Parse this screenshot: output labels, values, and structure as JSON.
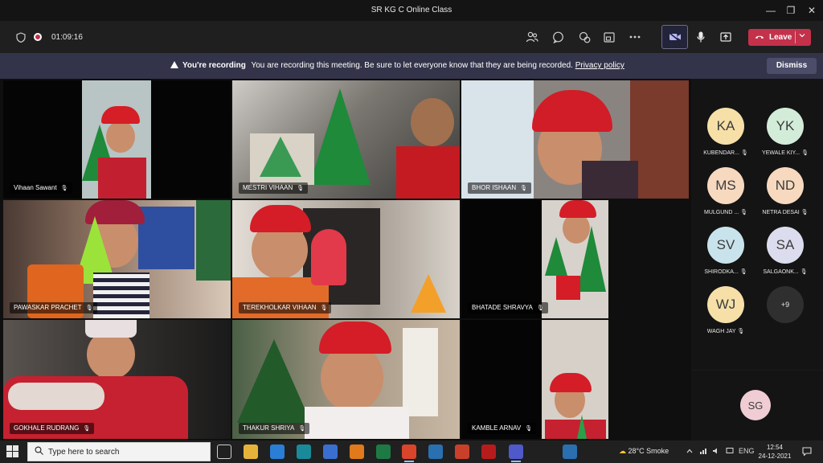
{
  "window": {
    "title": "SR KG C Online Class",
    "minimize_glyph": "—",
    "maximize_glyph": "❐",
    "close_glyph": "✕"
  },
  "toolbar": {
    "timer": "01:09:16",
    "leave_label": "Leave",
    "icons": [
      "shield-icon",
      "recording-icon",
      "people-icon",
      "chat-icon",
      "react-icon",
      "rooms-icon",
      "more-icon",
      "camera-off-icon",
      "mic-icon",
      "share-icon"
    ]
  },
  "banner": {
    "heading": "You're recording",
    "message": "You are recording this meeting. Be sure to let everyone know that they are being recorded.",
    "link": "Privacy policy",
    "dismiss_label": "Dismiss"
  },
  "tiles": [
    {
      "name": "Vihaan Sawant"
    },
    {
      "name": "MESTRI VIHAAN"
    },
    {
      "name": "BHOR ISHAAN"
    },
    {
      "name": "PAWASKAR PRACHET"
    },
    {
      "name": "TEREKHOLKAR VIHAAN"
    },
    {
      "name": "BHATADE SHRAVYA"
    },
    {
      "name": "GOKHALE RUDRANG"
    },
    {
      "name": "THAKUR SHRIYA"
    },
    {
      "name": "KAMBLE ARNAV"
    }
  ],
  "participants": [
    {
      "initials": "KA",
      "name": "KUBENDAR...",
      "color": "#f6e0a8"
    },
    {
      "initials": "YK",
      "name": "YEWALE KIY...",
      "color": "#d3ecd9"
    },
    {
      "initials": "MS",
      "name": "MULGUND ...",
      "color": "#f7d9bf"
    },
    {
      "initials": "ND",
      "name": "NETRA DESAI",
      "color": "#f7d9bf"
    },
    {
      "initials": "SV",
      "name": "SHIRODKA...",
      "color": "#c9e3ec"
    },
    {
      "initials": "SA",
      "name": "SALGAONK...",
      "color": "#dcdcef"
    },
    {
      "initials": "WJ",
      "name": "WAGH JAY",
      "color": "#f6e0a8"
    }
  ],
  "more_count": "+9",
  "self_initials": "SG",
  "taskbar": {
    "search_placeholder": "Type here to search",
    "weather": "28°C  Smoke",
    "lang": "ENG",
    "time": "12:54",
    "date": "24-12-2021"
  },
  "colors": {
    "leave": "#c4314b",
    "banner": "#33344a",
    "toolbar": "#1f1f1f"
  }
}
